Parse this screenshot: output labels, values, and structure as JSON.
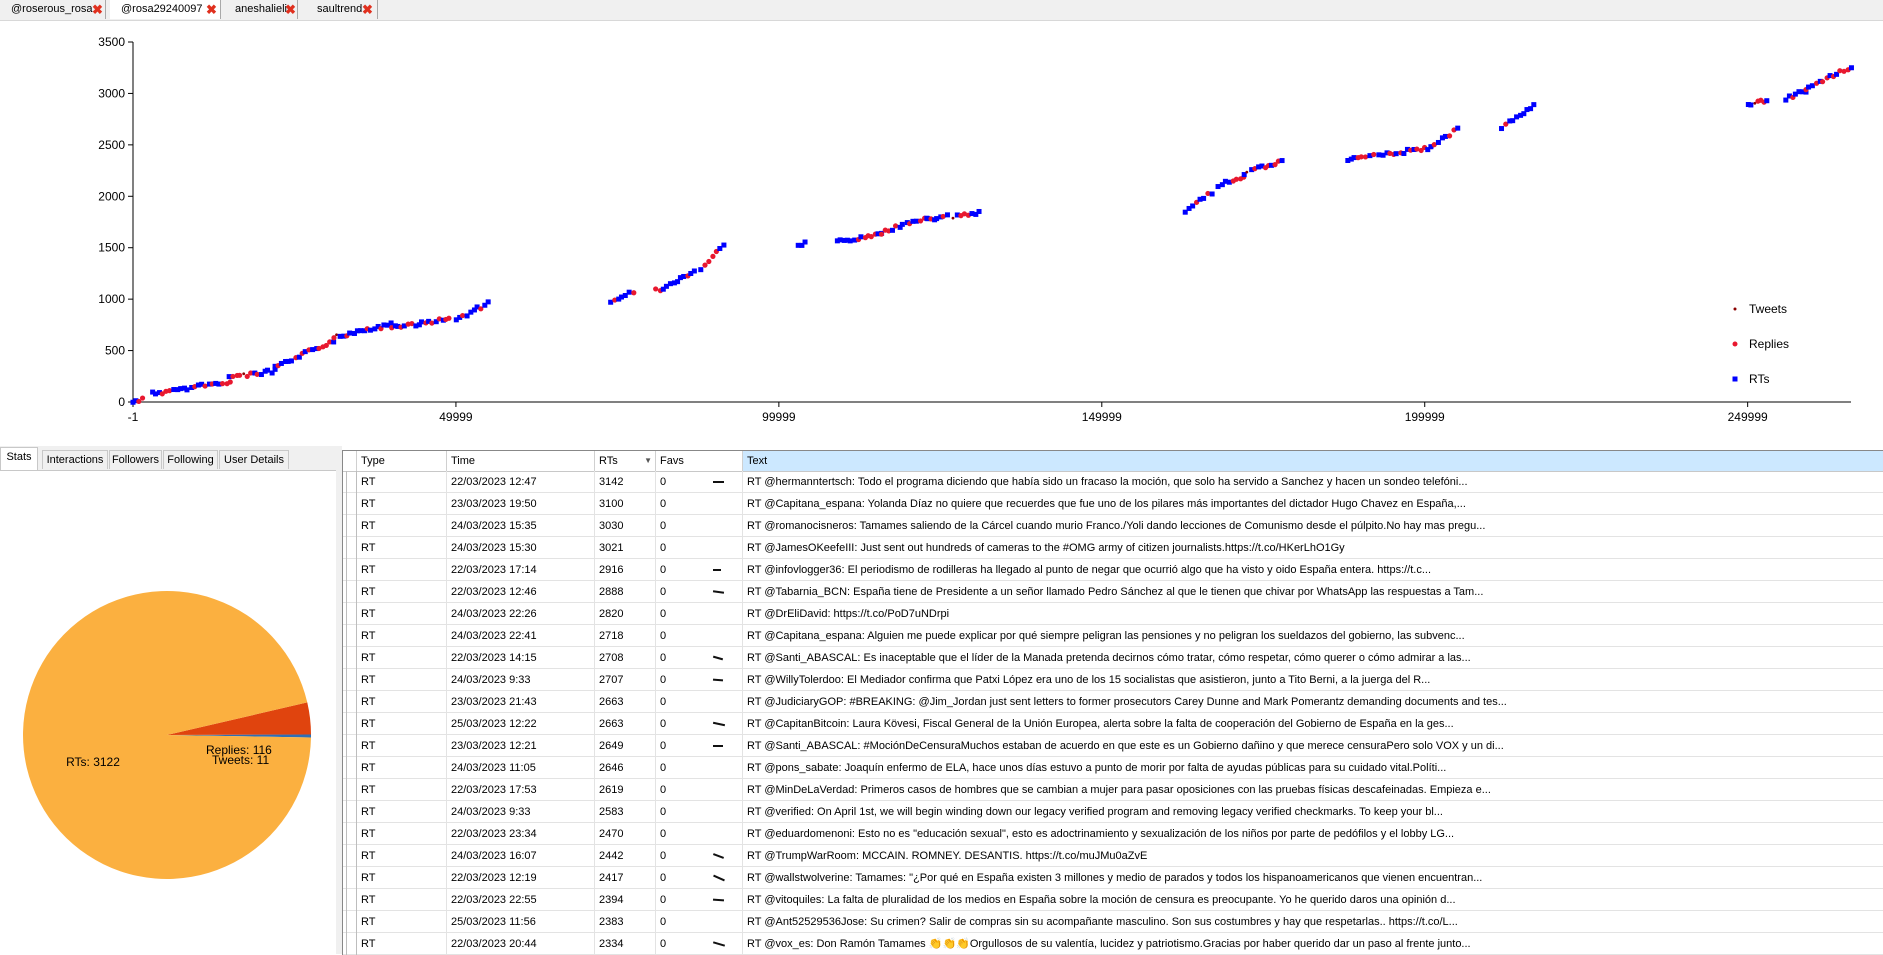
{
  "tabs": [
    {
      "label": "@roserous_rosa",
      "closable": true
    },
    {
      "label": "@rosa29240097",
      "closable": true,
      "active": true
    },
    {
      "label": "aneshalieli",
      "closable": true
    },
    {
      "label": "saultrend",
      "closable": true
    }
  ],
  "close_glyph": "✖",
  "chart_data": {
    "type": "scatter",
    "title": "",
    "xlabel": "",
    "ylabel": "",
    "xlim": [
      -1,
      266000
    ],
    "ylim": [
      0,
      3500
    ],
    "x_ticks": [
      "-1",
      "49999",
      "99999",
      "149999",
      "199999",
      "249999"
    ],
    "y_ticks": [
      "0",
      "500",
      "1000",
      "1500",
      "2000",
      "2500",
      "3000",
      "3500"
    ],
    "legend_position": "right",
    "grid": false,
    "series": [
      {
        "name": "Tweets",
        "color": "#8b0000",
        "marker": "small-dot"
      },
      {
        "name": "Replies",
        "color": "#e8182f",
        "marker": "dot"
      },
      {
        "name": "RTs",
        "color": "#0000ff",
        "marker": "square"
      }
    ],
    "segments": [
      {
        "x": [
          -1,
          1500
        ],
        "y": [
          0,
          30
        ]
      },
      {
        "x": [
          3000,
          15000
        ],
        "y": [
          80,
          200
        ]
      },
      {
        "x": [
          15000,
          22000
        ],
        "y": [
          240,
          300
        ]
      },
      {
        "x": [
          22000,
          31000
        ],
        "y": [
          330,
          600
        ]
      },
      {
        "x": [
          31000,
          40000
        ],
        "y": [
          630,
          750
        ]
      },
      {
        "x": [
          40000,
          49000
        ],
        "y": [
          720,
          810
        ]
      },
      {
        "x": [
          50000,
          55000
        ],
        "y": [
          800,
          960
        ]
      },
      {
        "x": [
          74000,
          77500
        ],
        "y": [
          960,
          1080
        ]
      },
      {
        "x": [
          81000,
          87000
        ],
        "y": [
          1080,
          1260
        ]
      },
      {
        "x": [
          88000,
          91500
        ],
        "y": [
          1280,
          1540
        ]
      },
      {
        "x": [
          103000,
          104000
        ],
        "y": [
          1520,
          1540
        ]
      },
      {
        "x": [
          109000,
          116000
        ],
        "y": [
          1550,
          1640
        ]
      },
      {
        "x": [
          116000,
          123000
        ],
        "y": [
          1650,
          1790
        ]
      },
      {
        "x": [
          123000,
          126000
        ],
        "y": [
          1780,
          1800
        ]
      },
      {
        "x": [
          127000,
          131000
        ],
        "y": [
          1800,
          1850
        ]
      },
      {
        "x": [
          163000,
          167000
        ],
        "y": [
          1840,
          2040
        ]
      },
      {
        "x": [
          168000,
          172000
        ],
        "y": [
          2100,
          2200
        ]
      },
      {
        "x": [
          172000,
          178000
        ],
        "y": [
          2230,
          2340
        ]
      },
      {
        "x": [
          188000,
          192000
        ],
        "y": [
          2350,
          2390
        ]
      },
      {
        "x": [
          193000,
          201000
        ],
        "y": [
          2400,
          2470
        ]
      },
      {
        "x": [
          201000,
          205000
        ],
        "y": [
          2490,
          2650
        ]
      },
      {
        "x": [
          212000,
          217000
        ],
        "y": [
          2670,
          2880
        ]
      },
      {
        "x": [
          250000,
          253000
        ],
        "y": [
          2890,
          2930
        ]
      },
      {
        "x": [
          256000,
          259000
        ],
        "y": [
          2950,
          3030
        ]
      },
      {
        "x": [
          259000,
          266000
        ],
        "y": [
          3050,
          3260
        ]
      }
    ]
  },
  "side_tabs": [
    "Stats",
    "Interactions",
    "Followers",
    "Following",
    "User Details"
  ],
  "pie_chart": {
    "type": "pie",
    "slices": [
      {
        "label": "RTs: 3122",
        "value": 3122,
        "color": "#fbb040"
      },
      {
        "label": "Replies: 116",
        "value": 116,
        "color": "#e0440e"
      },
      {
        "label": "Tweets: 11",
        "value": 11,
        "color": "#2e6fb5"
      }
    ]
  },
  "table": {
    "columns": [
      "Type",
      "Time",
      "RTs",
      "Favs",
      "Text"
    ],
    "sort_arrow": "▼",
    "rows": [
      {
        "type": "RT",
        "time": "22/03/2023 12:47",
        "rts": "3142",
        "favs": "0",
        "text": "RT @hermanntertsch: Todo el programa diciendo que había sido un fracaso la moción, que solo ha servido a Sanchez y hacen un sondeo telefóni..."
      },
      {
        "type": "RT",
        "time": "23/03/2023 19:50",
        "rts": "3100",
        "favs": "0",
        "text": "RT @Capitana_espana: Yolanda Díaz no quiere que  recuerdes que fue uno de los pilares más importantes del dictador Hugo Chavez  en España,..."
      },
      {
        "type": "RT",
        "time": "24/03/2023 15:35",
        "rts": "3030",
        "favs": "0",
        "text": "RT @romanocisneros: Tamames saliendo de la Cárcel cuando murio Franco./Yoli dando lecciones de Comunismo desde el púlpito.No hay mas pregu..."
      },
      {
        "type": "RT",
        "time": "24/03/2023 15:30",
        "rts": "3021",
        "favs": "0",
        "text": "RT @JamesOKeefeIII: Just sent out hundreds of cameras to the #OMG army of citizen journalists.https://t.co/HKerLhO1Gy"
      },
      {
        "type": "RT",
        "time": "22/03/2023 17:14",
        "rts": "2916",
        "favs": "0",
        "text": "RT @infovlogger36: El periodismo de rodilleras ha llegado al punto de negar que ocurrió algo que ha visto y oido España entera. https://t.c..."
      },
      {
        "type": "RT",
        "time": "22/03/2023 12:46",
        "rts": "2888",
        "favs": "0",
        "text": "RT @Tabarnia_BCN: España tiene de Presidente a un señor llamado Pedro Sánchez al que le tienen que chivar por WhatsApp las respuestas a Tam..."
      },
      {
        "type": "RT",
        "time": "24/03/2023 22:26",
        "rts": "2820",
        "favs": "0",
        "text": "RT @DrEliDavid: https://t.co/PoD7uNDrpi"
      },
      {
        "type": "RT",
        "time": "24/03/2023 22:41",
        "rts": "2718",
        "favs": "0",
        "text": "RT @Capitana_espana: Alguien me puede explicar por qué siempre peligran las pensiones y no peligran los sueldazos del gobierno, las subvenc..."
      },
      {
        "type": "RT",
        "time": "22/03/2023 14:15",
        "rts": "2708",
        "favs": "0",
        "text": "RT @Santi_ABASCAL: Es inaceptable que el líder de la Manada pretenda decirnos cómo tratar, cómo respetar, cómo querer o cómo admirar a las..."
      },
      {
        "type": "RT",
        "time": "24/03/2023 9:33",
        "rts": "2707",
        "favs": "0",
        "text": "RT @WillyTolerdoo: El Mediador confirma que Patxi López era uno de los 15 socialistas que asistieron, junto a Tito Berni, a la juerga del R..."
      },
      {
        "type": "RT",
        "time": "23/03/2023 21:43",
        "rts": "2663",
        "favs": "0",
        "text": "RT @JudiciaryGOP: #BREAKING: @Jim_Jordan just sent letters to former prosecutors Carey Dunne and Mark Pomerantz demanding documents and tes..."
      },
      {
        "type": "RT",
        "time": "25/03/2023 12:22",
        "rts": "2663",
        "favs": "0",
        "text": "RT @CapitanBitcoin: Laura Kövesi, Fiscal General de la Unión Europea, alerta sobre la falta de cooperación del Gobierno de España en la ges..."
      },
      {
        "type": "RT",
        "time": "23/03/2023 12:21",
        "rts": "2649",
        "favs": "0",
        "text": "RT @Santi_ABASCAL: #MociónDeCensuraMuchos estaban de acuerdo en que este es un Gobierno dañino y que merece censuraPero solo VOX y un di..."
      },
      {
        "type": "RT",
        "time": "24/03/2023 11:05",
        "rts": "2646",
        "favs": "0",
        "text": "RT @pons_sabate: Joaquín enfermo de ELA, hace unos días estuvo a punto de morir por falta de ayudas públicas para su cuidado vital.Políti..."
      },
      {
        "type": "RT",
        "time": "22/03/2023 17:53",
        "rts": "2619",
        "favs": "0",
        "text": "RT @MinDeLaVerdad: Primeros casos de hombres que se cambian a mujer para pasar oposiciones con las pruebas físicas descafeinadas. Empieza e..."
      },
      {
        "type": "RT",
        "time": "24/03/2023 9:33",
        "rts": "2583",
        "favs": "0",
        "text": "RT @verified: On April 1st, we will begin winding down our legacy verified program and removing legacy verified checkmarks. To keep your bl..."
      },
      {
        "type": "RT",
        "time": "22/03/2023 23:34",
        "rts": "2470",
        "favs": "0",
        "text": "RT @eduardomenoni: Esto no es \"educación sexual\", esto es adoctrinamiento y sexualización de los niños por parte de pedófilos y el lobby LG..."
      },
      {
        "type": "RT",
        "time": "24/03/2023 16:07",
        "rts": "2442",
        "favs": "0",
        "text": "RT @TrumpWarRoom: MCCAIN. ROMNEY. DESANTIS. https://t.co/muJMu0aZvE"
      },
      {
        "type": "RT",
        "time": "22/03/2023 12:19",
        "rts": "2417",
        "favs": "0",
        "text": "RT @wallstwolverine: Tamames: \"¿Por qué en España existen 3 millones y medio de parados y todos los hispanoamericanos que vienen encuentran..."
      },
      {
        "type": "RT",
        "time": "22/03/2023 22:55",
        "rts": "2394",
        "favs": "0",
        "text": "RT @vitoquiles: La falta de pluralidad de los medios en España sobre la moción de censura es preocupante. Yo he querido daros una opinión d..."
      },
      {
        "type": "RT",
        "time": "25/03/2023 11:56",
        "rts": "2383",
        "favs": "0",
        "text": "RT @Ant52529536Jose: Su crimen? Salir de compras sin su acompañante masculino.  Son sus costumbres y hay que respetarlas.. https://t.co/L..."
      },
      {
        "type": "RT",
        "time": "22/03/2023 20:44",
        "rts": "2334",
        "favs": "0",
        "text": "RT @vox_es: Don Ramón Tamames 👏👏👏Orgullosos de su valentía, lucidez y patriotismo.Gracias por haber querido dar un paso al frente junto..."
      }
    ]
  }
}
